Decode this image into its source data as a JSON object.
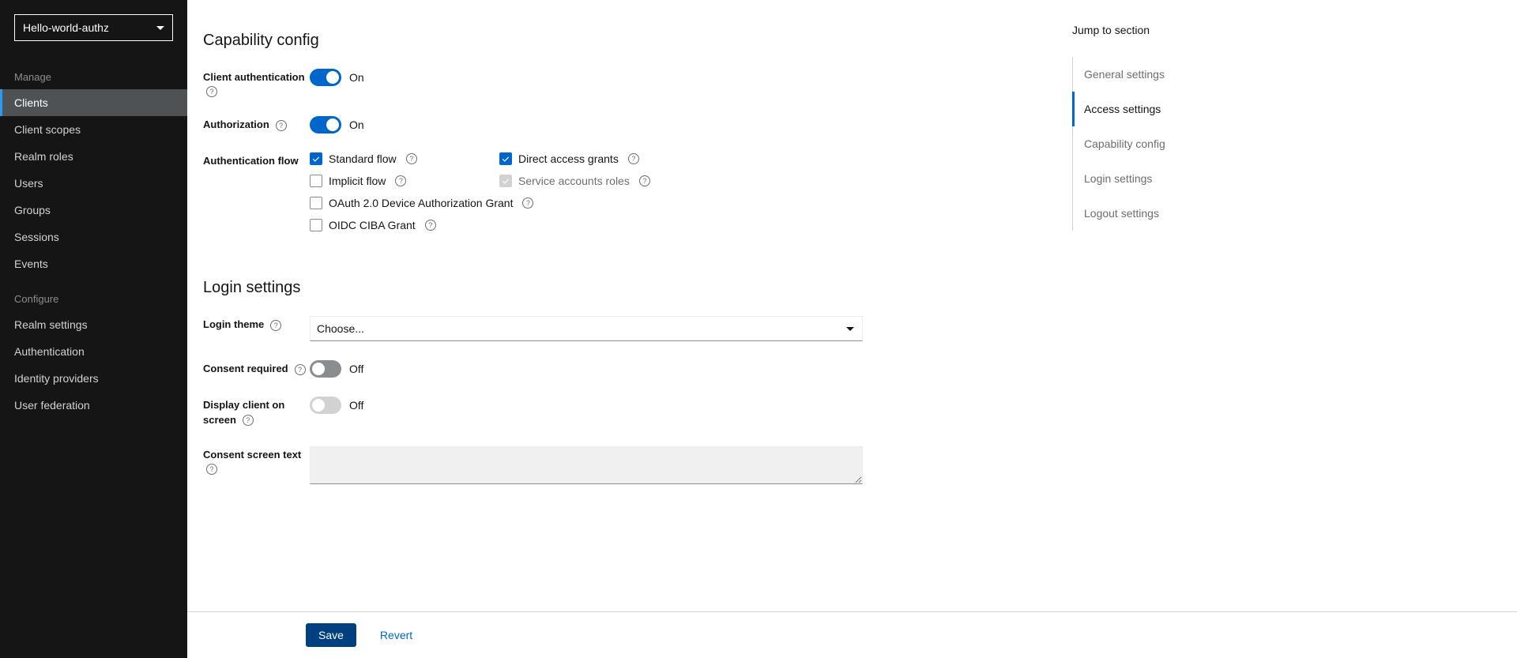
{
  "sidebar": {
    "realm": "Hello-world-authz",
    "sections": [
      {
        "title": "Manage",
        "items": [
          {
            "label": "Clients",
            "active": true
          },
          {
            "label": "Client scopes"
          },
          {
            "label": "Realm roles"
          },
          {
            "label": "Users"
          },
          {
            "label": "Groups"
          },
          {
            "label": "Sessions"
          },
          {
            "label": "Events"
          }
        ]
      },
      {
        "title": "Configure",
        "items": [
          {
            "label": "Realm settings"
          },
          {
            "label": "Authentication"
          },
          {
            "label": "Identity providers"
          },
          {
            "label": "User federation"
          }
        ]
      }
    ]
  },
  "capability": {
    "heading": "Capability config",
    "client_auth": {
      "label": "Client authentication",
      "state": "On",
      "on": true
    },
    "authorization": {
      "label": "Authorization",
      "state": "On",
      "on": true
    },
    "auth_flow": {
      "label": "Authentication flow",
      "options": [
        {
          "label": "Standard flow",
          "checked": true
        },
        {
          "label": "Direct access grants",
          "checked": true
        },
        {
          "label": "Implicit flow",
          "checked": false
        },
        {
          "label": "Service accounts roles",
          "checked": true,
          "disabled": true
        },
        {
          "label": "OAuth 2.0 Device Authorization Grant",
          "checked": false
        },
        {
          "label": "OIDC CIBA Grant",
          "checked": false
        }
      ]
    }
  },
  "login": {
    "heading": "Login settings",
    "theme": {
      "label": "Login theme",
      "value": "Choose..."
    },
    "consent_required": {
      "label": "Consent required",
      "state": "Off",
      "on": false
    },
    "display_client": {
      "label": "Display client on screen",
      "state": "Off",
      "on": false,
      "disabled": true
    },
    "consent_text": {
      "label": "Consent screen text",
      "value": ""
    }
  },
  "footer": {
    "save": "Save",
    "revert": "Revert"
  },
  "jump": {
    "title": "Jump to section",
    "items": [
      {
        "label": "General settings"
      },
      {
        "label": "Access settings",
        "active": true
      },
      {
        "label": "Capability config"
      },
      {
        "label": "Login settings"
      },
      {
        "label": "Logout settings"
      }
    ]
  }
}
